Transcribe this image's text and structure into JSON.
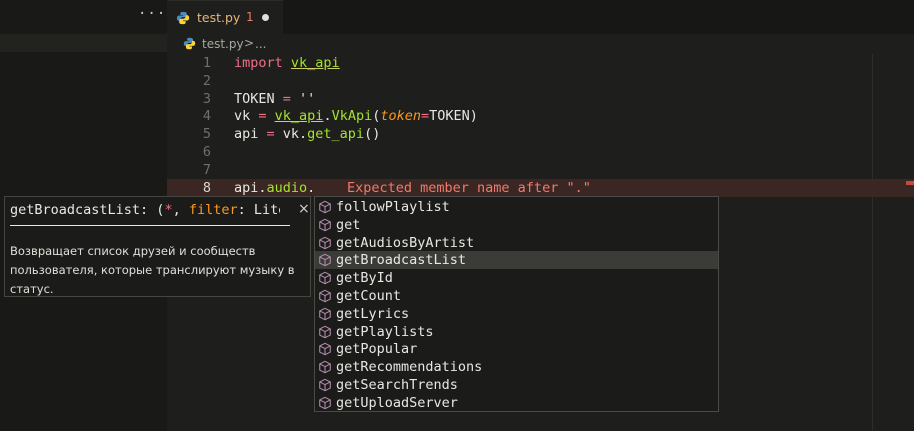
{
  "sidebar": {
    "more_label": "···"
  },
  "tab": {
    "filename": "test.py",
    "problem_count": "1"
  },
  "breadcrumb": {
    "file": "test.py",
    "separator": ">",
    "more": "..."
  },
  "editor": {
    "lines": [
      {
        "number": "1",
        "parts": [
          [
            "kw",
            "import"
          ],
          [
            "plain",
            " "
          ],
          [
            "mod",
            "vk_api"
          ]
        ]
      },
      {
        "number": "2",
        "parts": []
      },
      {
        "number": "3",
        "parts": [
          [
            "plain",
            "TOKEN "
          ],
          [
            "op",
            "="
          ],
          [
            "plain",
            " ''"
          ]
        ]
      },
      {
        "number": "4",
        "parts": [
          [
            "plain",
            "vk "
          ],
          [
            "op",
            "="
          ],
          [
            "plain",
            " "
          ],
          [
            "mod",
            "vk_api"
          ],
          [
            "plain",
            "."
          ],
          [
            "cls",
            "VkApi"
          ],
          [
            "plain",
            "("
          ],
          [
            "param",
            "token"
          ],
          [
            "op",
            "="
          ],
          [
            "plain",
            "TOKEN)"
          ]
        ]
      },
      {
        "number": "5",
        "parts": [
          [
            "plain",
            "api "
          ],
          [
            "op",
            "="
          ],
          [
            "plain",
            " vk."
          ],
          [
            "fn",
            "get_api"
          ],
          [
            "plain",
            "()"
          ]
        ]
      },
      {
        "number": "6",
        "parts": []
      },
      {
        "number": "7",
        "parts": []
      },
      {
        "number": "8",
        "parts": [
          [
            "plain",
            "api."
          ],
          [
            "fn",
            "audio"
          ],
          [
            "plain",
            "."
          ]
        ],
        "error": "Expected member name after \".\""
      }
    ]
  },
  "hover": {
    "signature_name": "getBroadcastList: (",
    "signature_star": "*",
    "signature_sep": ", ",
    "signature_param": "filter",
    "signature_rest": ": Liter",
    "close_label": "×",
    "description": "Возвращает список друзей и сообществ пользователя, которые транслируют музыку в статус."
  },
  "suggestions": {
    "selected_index": 3,
    "items": [
      "followPlaylist",
      "get",
      "getAudiosByArtist",
      "getBroadcastList",
      "getById",
      "getCount",
      "getLyrics",
      "getPlaylists",
      "getPopular",
      "getRecommendations",
      "getSearchTrends",
      "getUploadServer"
    ]
  },
  "colors": {
    "keyword": "#f06e86",
    "function": "#a6e22e",
    "parameter": "#fd971f",
    "error": "#f07a6b",
    "background": "#1e1f1c"
  }
}
